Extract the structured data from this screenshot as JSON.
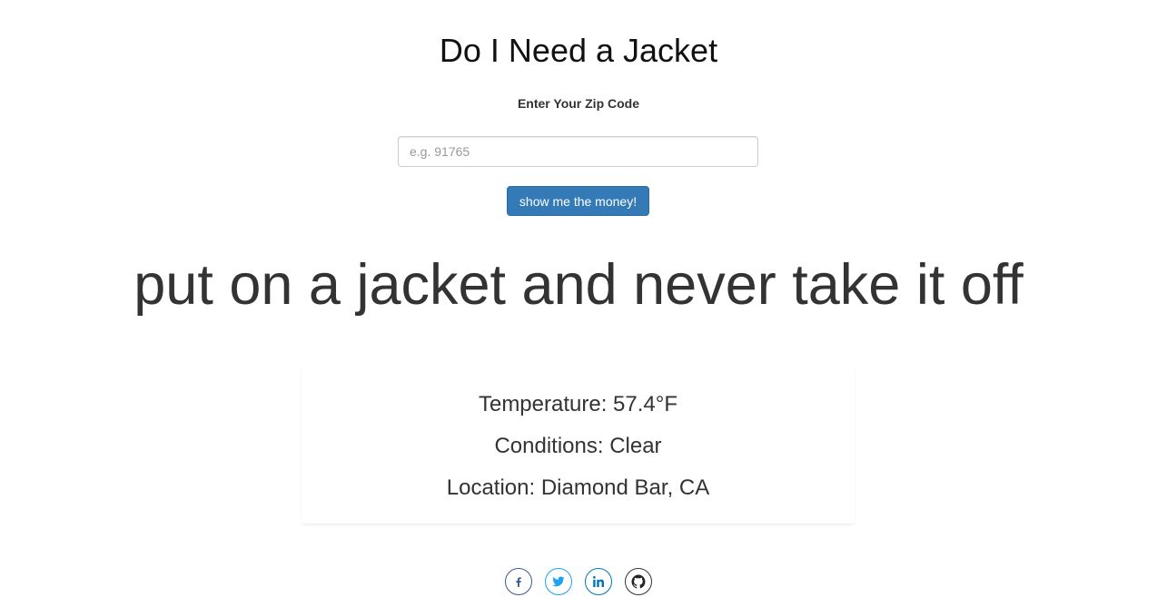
{
  "header": {
    "title": "Do I Need a Jacket"
  },
  "form": {
    "label": "Enter Your Zip Code",
    "placeholder": "e.g. 91765",
    "value": "",
    "submit_label": "show me the money!"
  },
  "result": {
    "verdict": "put on a jacket and never take it off",
    "temperature": "Temperature: 57.4°F",
    "conditions": "Conditions: Clear",
    "location": "Location: Diamond Bar, CA"
  },
  "social": [
    {
      "icon": "facebook-icon",
      "color": "#3b5998"
    },
    {
      "icon": "twitter-icon",
      "color": "#1da1f2"
    },
    {
      "icon": "linkedin-icon",
      "color": "#0077b5"
    },
    {
      "icon": "github-icon",
      "color": "#333333"
    }
  ],
  "colors": {
    "primary_button": "#337ab7",
    "text": "#333333"
  }
}
